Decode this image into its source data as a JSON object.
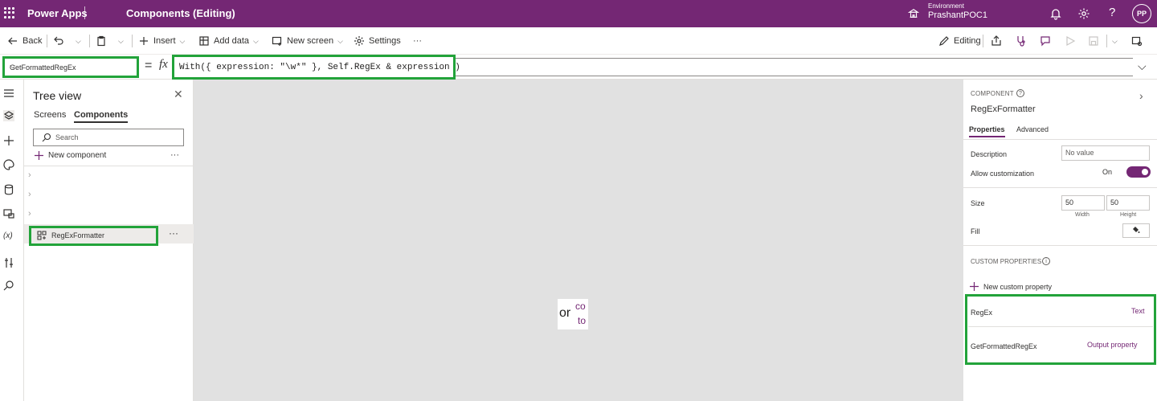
{
  "app": {
    "name": "Power Apps",
    "document_title": "Components (Editing)",
    "environment_label": "Environment",
    "environment_name": "PrashantPOC1",
    "user_initials": "PP",
    "help_glyph": "?",
    "brand_color": "#742774"
  },
  "toolbar": {
    "back": "Back",
    "insert": "Insert",
    "add_data": "Add data",
    "new_screen": "New screen",
    "settings": "Settings",
    "more": "···",
    "editing": "Editing"
  },
  "formula_bar": {
    "property": "GetFormattedRegEx",
    "equals": "=",
    "fx": "fx",
    "formula": "With({ expression: \"\\w*\" }, Self.RegEx & expression )"
  },
  "tree_view": {
    "title": "Tree view",
    "tabs": [
      "Screens",
      "Components"
    ],
    "active_tab": "Components",
    "search_placeholder": "Search",
    "new_component": "New component",
    "more": "···",
    "selected_item": "RegExFormatter"
  },
  "canvas": {
    "preview_text": "or",
    "preview_line1": "co",
    "preview_line2": "to"
  },
  "properties_panel": {
    "section_label": "COMPONENT",
    "component_name": "RegExFormatter",
    "tabs": [
      "Properties",
      "Advanced"
    ],
    "active_tab": "Properties",
    "description_label": "Description",
    "description_value": "No value",
    "allow_customization_label": "Allow customization",
    "allow_customization_value": "On",
    "size_label": "Size",
    "width_value": "50",
    "height_value": "50",
    "width_caption": "Width",
    "height_caption": "Height",
    "fill_label": "Fill",
    "custom_properties_label": "CUSTOM PROPERTIES",
    "new_custom_property": "New custom property",
    "custom_properties": [
      {
        "name": "RegEx",
        "type": "Text"
      },
      {
        "name": "GetFormattedRegEx",
        "type": "Output property"
      }
    ]
  },
  "highlight_color": "#22a33a"
}
